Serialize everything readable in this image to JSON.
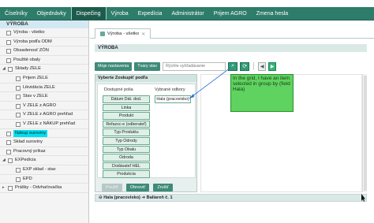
{
  "nav": {
    "items": [
      "Číselníky",
      "Objednávky",
      "Dispečing",
      "Výroba",
      "Expedícia",
      "Administrátor",
      "Prijem AGRO",
      "Zmena hesla"
    ],
    "active": "Dispečing"
  },
  "sidebar": {
    "header": "VÝROBA",
    "items": [
      {
        "label": "Výroba - všetko"
      },
      {
        "label": "Výroba podľa ODM"
      },
      {
        "label": "Obsadenosť ZÓN"
      },
      {
        "label": "Použité obaly"
      },
      {
        "label": "Sklady ZELE"
      },
      {
        "label": "Prijem ZELE"
      },
      {
        "label": "Likvidácia ZELE"
      },
      {
        "label": "Stav v ZELE"
      },
      {
        "label": "V ZELE z AGRO"
      },
      {
        "label": "V ZELE z AGRO prehľad"
      },
      {
        "label": "V ZELE z NÁKUP prehľad"
      },
      {
        "label": "Nákup suroviny"
      },
      {
        "label": "Sklad suroviny"
      },
      {
        "label": "Pracovný príkaz"
      },
      {
        "label": "EXPedícia"
      },
      {
        "label": "EXP sklad - stav"
      },
      {
        "label": "EPD"
      },
      {
        "label": "Prášky - Odvhaťovačka"
      }
    ]
  },
  "tab": {
    "label": "Výroba - všetko"
  },
  "pane": {
    "title": "VÝROBA"
  },
  "toolbar": {
    "settings_label": "Moje nastavenia",
    "views_label": "Tvary stav",
    "search_placeholder": "Rýchle vyhľadávanie"
  },
  "group": {
    "title": "Vyberte Zoskupiť podľa",
    "available_header": "Dostupné polia",
    "selected_header": "Vybrané odbory",
    "available": [
      "Dátum Dát. dod.",
      "Linka",
      "Produkt",
      "Refazsc-e (odberateľ)",
      "Typ Produktu",
      "Typ Odrody",
      "Typ Obalu",
      "Odroda",
      "Dodávateľ HEL",
      "Produkcia"
    ],
    "selected": [
      "Hala (pracovisko)"
    ],
    "buttons": {
      "apply": "Použiť",
      "refresh": "Obnoviť",
      "cancel": "Zrušiť"
    }
  },
  "note": "In the grid, I have an item selected in group by (field Hala)",
  "status": "Hala (pracovisko) ➜ Baliareň č. 1",
  "icons": {
    "search": "search-icon",
    "refresh": "refresh-icon",
    "prev": "prev-icon",
    "next": "next-icon",
    "close": "close-icon"
  }
}
